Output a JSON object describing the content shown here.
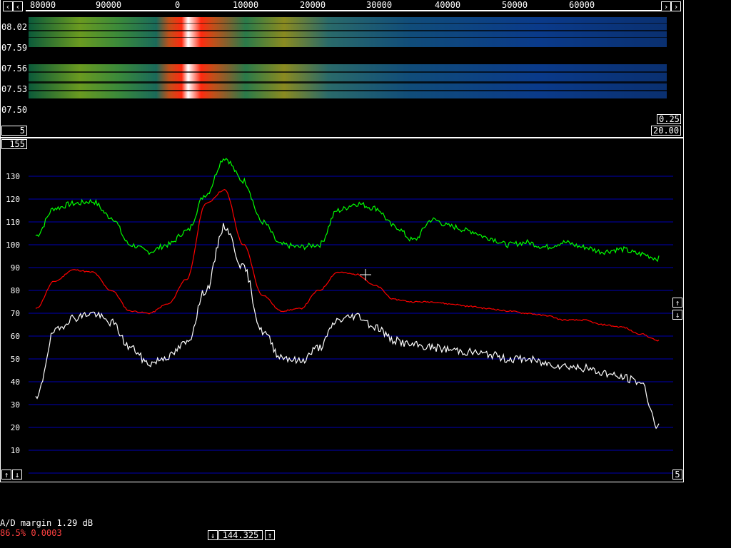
{
  "freq_axis": {
    "scroll_left_icon": "chevron-left-icon",
    "scroll_right_icon": "chevron-right-icon",
    "labels": [
      "80000",
      "90000",
      "0",
      "10000",
      "20000",
      "30000",
      "40000",
      "50000",
      "60000"
    ]
  },
  "waterfall": {
    "time_labels": [
      "08.02",
      "07.59",
      "07.56",
      "07.53",
      "07.50"
    ],
    "left_value": "5",
    "right_top_value": "0.25",
    "right_bottom_value": "20.00"
  },
  "spectrum": {
    "top_value": "155",
    "y_labels": [
      "130",
      "120",
      "110",
      "100",
      "90",
      "80",
      "70",
      "60",
      "50",
      "40",
      "30",
      "20",
      "10"
    ],
    "right_bottom_value": "5",
    "colors": {
      "grid": "#0000b4",
      "green": "#00ff00",
      "red": "#ff0000",
      "white": "#ffffff"
    }
  },
  "chart_data": {
    "type": "line",
    "title": "",
    "xlabel": "",
    "ylabel": "",
    "ylim": [
      0,
      155
    ],
    "x": [
      "80000",
      "90000",
      "0",
      "10000",
      "20000",
      "30000",
      "40000",
      "50000",
      "60000"
    ],
    "series": [
      {
        "values": [
          104,
          118,
          100,
          139,
          100,
          118,
          104,
          107,
          100,
          99,
          96
        ]
      },
      {
        "values": [
          72,
          89,
          70,
          124,
          71,
          88,
          75,
          72,
          69,
          66,
          59
        ]
      },
      {
        "values": [
          30,
          70,
          50,
          110,
          50,
          69,
          55,
          52,
          48,
          47,
          35
        ]
      }
    ]
  },
  "status": {
    "ad_margin": "A/D margin 1.29 dB",
    "ratio": "86.5% 0.0003",
    "freq": "144.325"
  }
}
